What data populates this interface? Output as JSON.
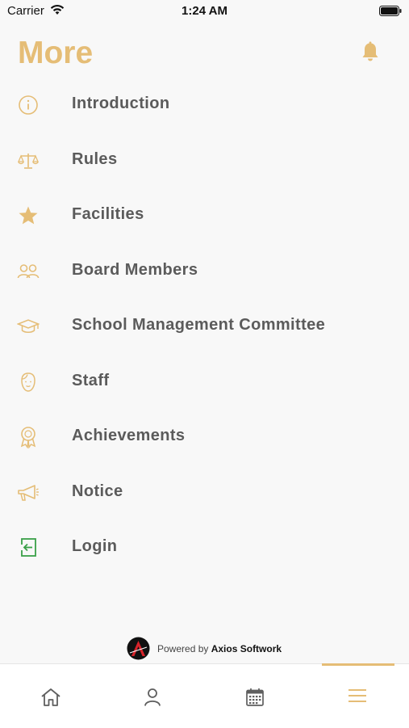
{
  "status": {
    "carrier": "Carrier",
    "time": "1:24 AM"
  },
  "header": {
    "title": "More"
  },
  "menu": [
    {
      "label": "Introduction",
      "icon": "info-icon"
    },
    {
      "label": "Rules",
      "icon": "scales-icon"
    },
    {
      "label": "Facilities",
      "icon": "star-icon"
    },
    {
      "label": "Board Members",
      "icon": "people-icon"
    },
    {
      "label": "School Management Committee",
      "icon": "graduation-cap-icon"
    },
    {
      "label": "Staff",
      "icon": "face-icon"
    },
    {
      "label": "Achievements",
      "icon": "award-icon"
    },
    {
      "label": "Notice",
      "icon": "megaphone-icon"
    },
    {
      "label": "Login",
      "icon": "login-icon"
    }
  ],
  "footer": {
    "powered_prefix": "Powered by",
    "company": "Axios Softwork"
  },
  "tabs": [
    {
      "name": "home",
      "icon": "home-icon"
    },
    {
      "name": "profile",
      "icon": "user-icon"
    },
    {
      "name": "calendar",
      "icon": "calendar-icon"
    },
    {
      "name": "more",
      "icon": "menu-icon",
      "active": true
    }
  ],
  "colors": {
    "accent": "#e5bd76",
    "text": "#5b5b5b",
    "login_icon": "#3aa048",
    "tab_icon": "#5f5f5f"
  }
}
